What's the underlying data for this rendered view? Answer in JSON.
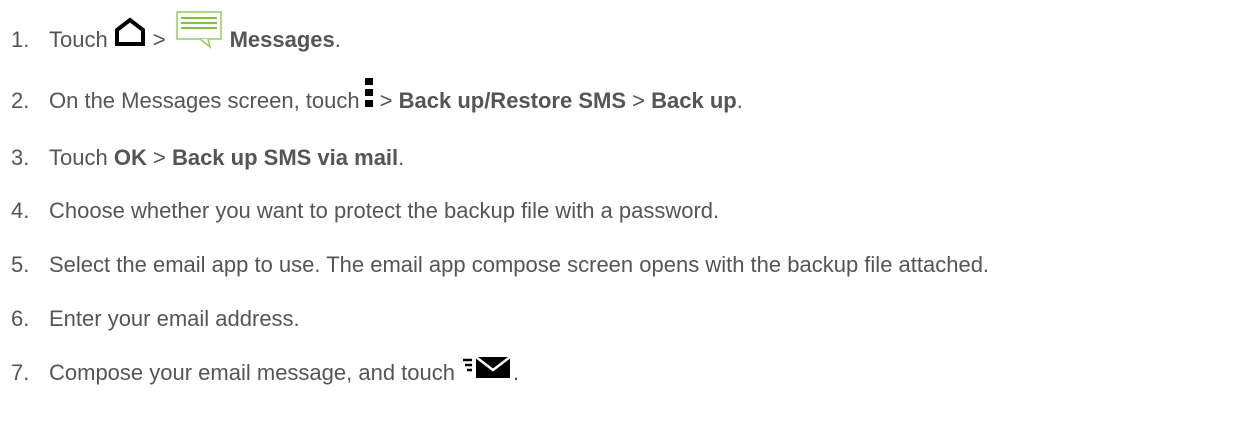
{
  "steps": [
    {
      "number": "1.",
      "parts": {
        "t1": "Touch",
        "home_icon": "home-icon",
        "sep1": ">",
        "messages_icon": "messages-app-icon",
        "bold1": "Messages",
        "end": "."
      }
    },
    {
      "number": "2.",
      "parts": {
        "t1": "On the Messages screen, touch",
        "menu_icon": "menu-icon",
        "sep1": ">",
        "bold1": "Back up/Restore SMS",
        "sep2": ">",
        "bold2": "Back up",
        "end": "."
      }
    },
    {
      "number": "3.",
      "parts": {
        "t1": "Touch",
        "bold1": "OK",
        "sep1": ">",
        "bold2": "Back up SMS via mail",
        "end": "."
      }
    },
    {
      "number": "4.",
      "parts": {
        "t1": "Choose whether you want to protect the backup file with a password."
      }
    },
    {
      "number": "5.",
      "parts": {
        "t1": "Select the email app to use. The email app compose screen opens with the backup file attached."
      }
    },
    {
      "number": "6.",
      "parts": {
        "t1": "Enter your email address."
      }
    },
    {
      "number": "7.",
      "parts": {
        "t1": "Compose your email message, and touch",
        "send_icon": "send-icon",
        "end": "."
      }
    }
  ]
}
